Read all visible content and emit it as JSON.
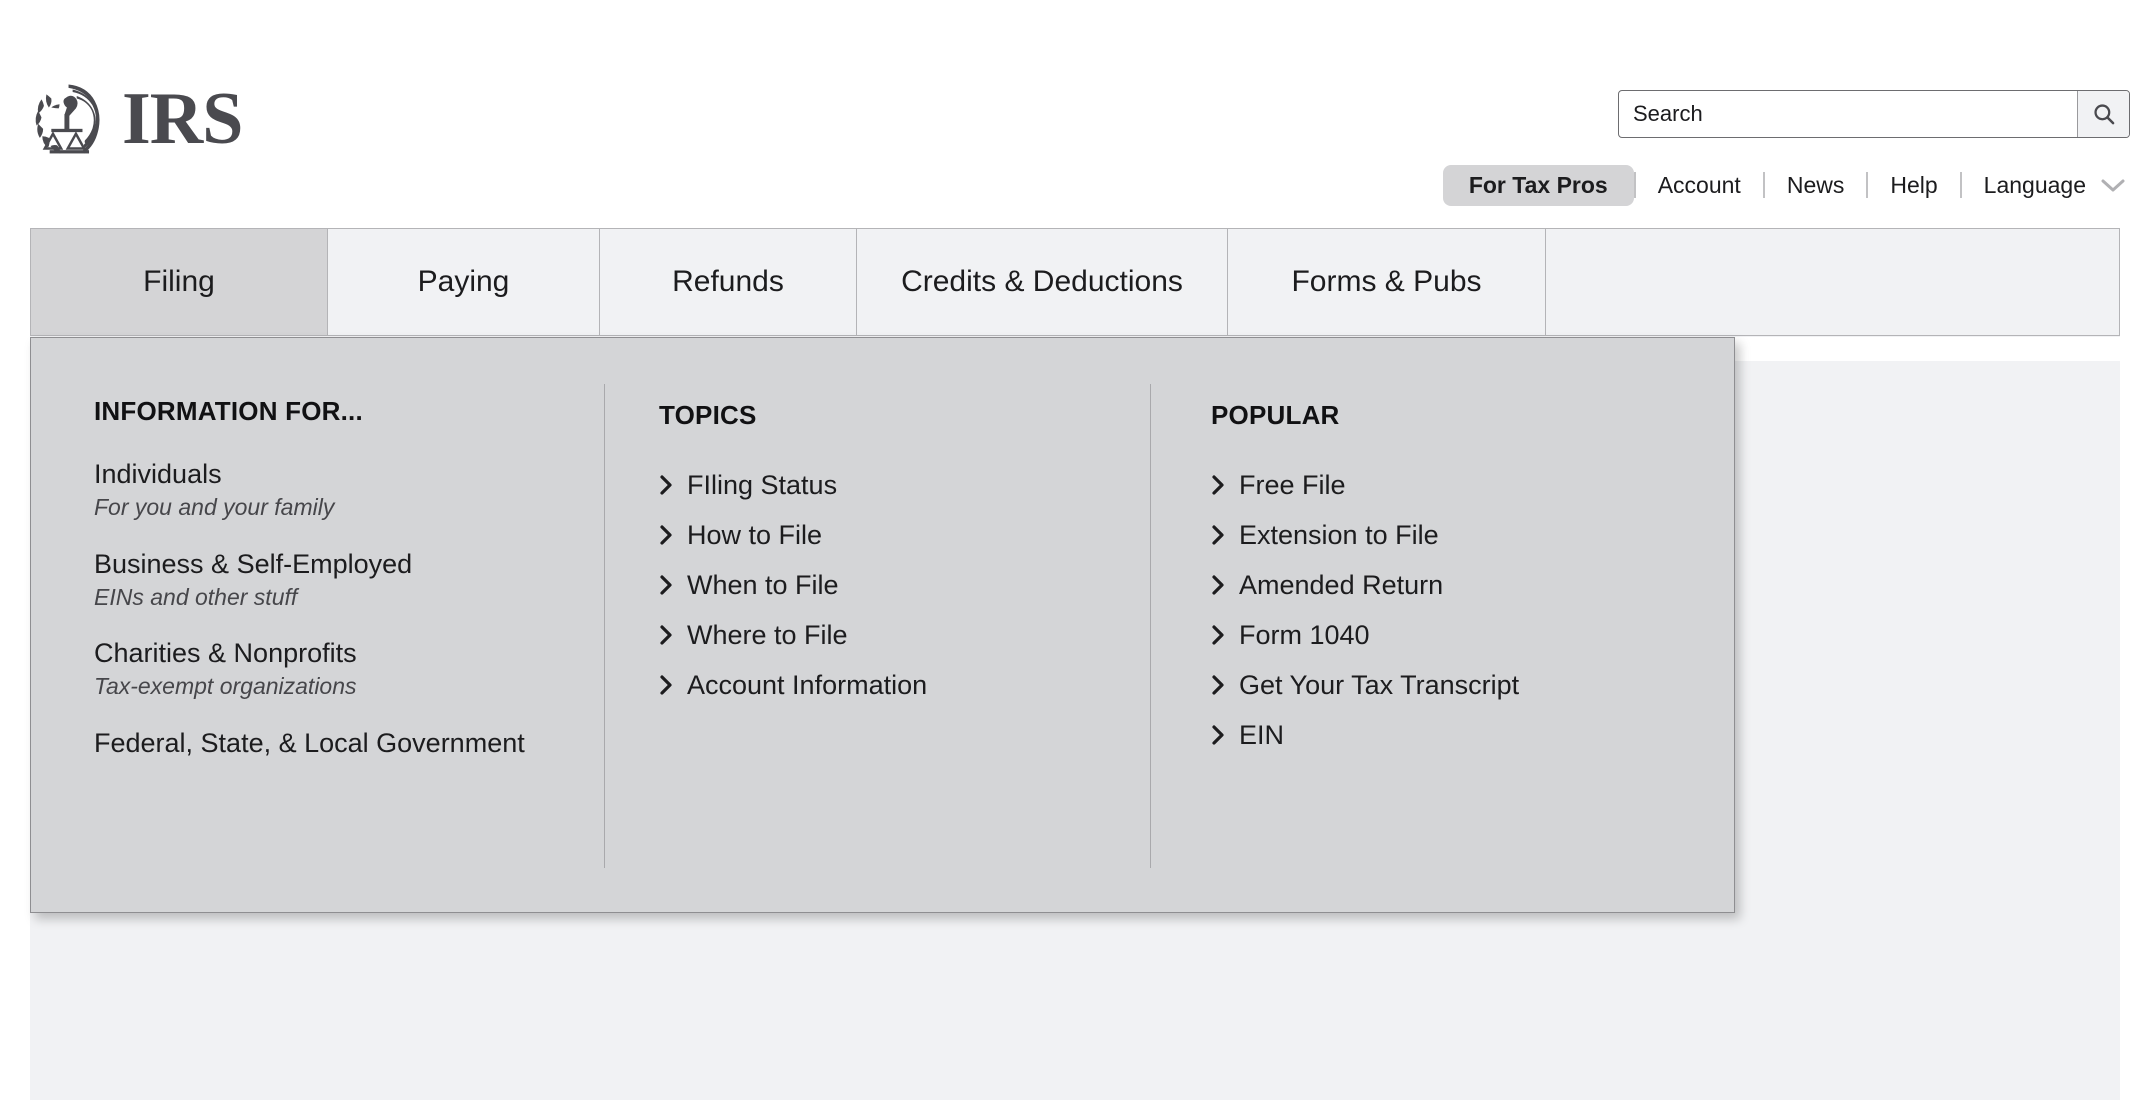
{
  "brand": {
    "name": "IRS",
    "emblem_icon": "irs-eagle-emblem-icon"
  },
  "search": {
    "placeholder": "Search",
    "value": "",
    "button_icon": "search-icon"
  },
  "utility_nav": {
    "pill": "For Tax Pros",
    "links": [
      "Account",
      "News",
      "Help"
    ],
    "language": {
      "label": "Language",
      "chevron_icon": "chevron-down-icon"
    }
  },
  "tabs": [
    {
      "label": "Filing",
      "active": true
    },
    {
      "label": "Paying",
      "active": false
    },
    {
      "label": "Refunds",
      "active": false
    },
    {
      "label": "Credits & Deductions",
      "active": false
    },
    {
      "label": "Forms & Pubs",
      "active": false
    }
  ],
  "mega_menu": {
    "information_for": {
      "heading": "INFORMATION FOR...",
      "items": [
        {
          "title": "Individuals",
          "subtitle": "For you and your family"
        },
        {
          "title": "Business & Self-Employed",
          "subtitle": "EINs and other stuff"
        },
        {
          "title": "Charities & Nonprofits",
          "subtitle": "Tax-exempt organizations"
        },
        {
          "title": "Federal, State, & Local Government",
          "subtitle": ""
        }
      ]
    },
    "topics": {
      "heading": "TOPICS",
      "items": [
        "FIling Status",
        "How to File",
        "When to File",
        "Where to File",
        "Account Information"
      ]
    },
    "popular": {
      "heading": "POPULAR",
      "items": [
        "Free File",
        "Extension to File",
        "Amended Return",
        "Form 1040",
        "Get Your Tax Transcript",
        "EIN"
      ]
    },
    "link_icon": "chevron-right-icon"
  },
  "colors": {
    "page_background": "#ffffff",
    "content_background": "#f1f2f4",
    "panel_background": "#d4d5d7",
    "active_tab": "#d4d4d6",
    "text": "#1c1c1e",
    "logo": "#4a4a4f",
    "border": "#b4b4b7"
  }
}
